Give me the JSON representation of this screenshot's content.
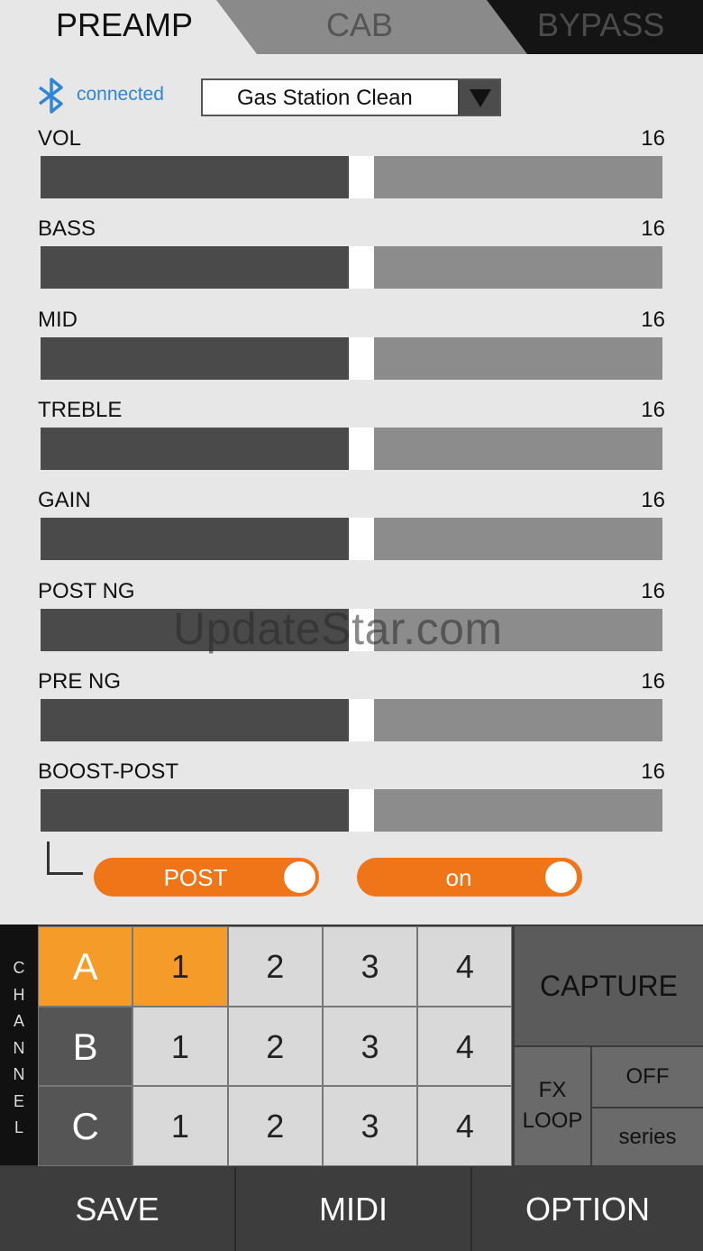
{
  "tabs": {
    "preamp": "PREAMP",
    "cab": "CAB",
    "bypass": "BYPASS"
  },
  "status": {
    "bluetooth_icon": "bluetooth-icon",
    "connection": "connected"
  },
  "preset": {
    "name": "Gas Station Clean",
    "dropdown_icon": "triangle-down-icon"
  },
  "params": [
    {
      "label": "VOL",
      "value": "16"
    },
    {
      "label": "BASS",
      "value": "16"
    },
    {
      "label": "MID",
      "value": "16"
    },
    {
      "label": "TREBLE",
      "value": "16"
    },
    {
      "label": "GAIN",
      "value": "16"
    },
    {
      "label": "POST NG",
      "value": "16"
    },
    {
      "label": "PRE NG",
      "value": "16"
    },
    {
      "label": "BOOST-POST",
      "value": "16"
    }
  ],
  "slider_level_fraction": 0.5,
  "toggles": {
    "boost_position": "POST",
    "boost_state": "on"
  },
  "channel": {
    "letters": [
      "C",
      "H",
      "A",
      "N",
      "N",
      "E",
      "L"
    ],
    "rows": [
      {
        "label": "A",
        "slots": [
          "1",
          "2",
          "3",
          "4"
        ]
      },
      {
        "label": "B",
        "slots": [
          "1",
          "2",
          "3",
          "4"
        ]
      },
      {
        "label": "C",
        "slots": [
          "1",
          "2",
          "3",
          "4"
        ]
      }
    ],
    "active_row": "A",
    "active_slot": "1"
  },
  "side": {
    "capture": "CAPTURE",
    "fx_line1": "FX",
    "fx_line2": "LOOP",
    "off": "OFF",
    "series": "series"
  },
  "bottom": {
    "save": "SAVE",
    "midi": "MIDI",
    "option": "OPTION"
  },
  "watermark": "UpdateStar.com",
  "colors": {
    "accent": "#f59b29",
    "toggle": "#f07418",
    "bluetooth": "#2e86d6"
  }
}
